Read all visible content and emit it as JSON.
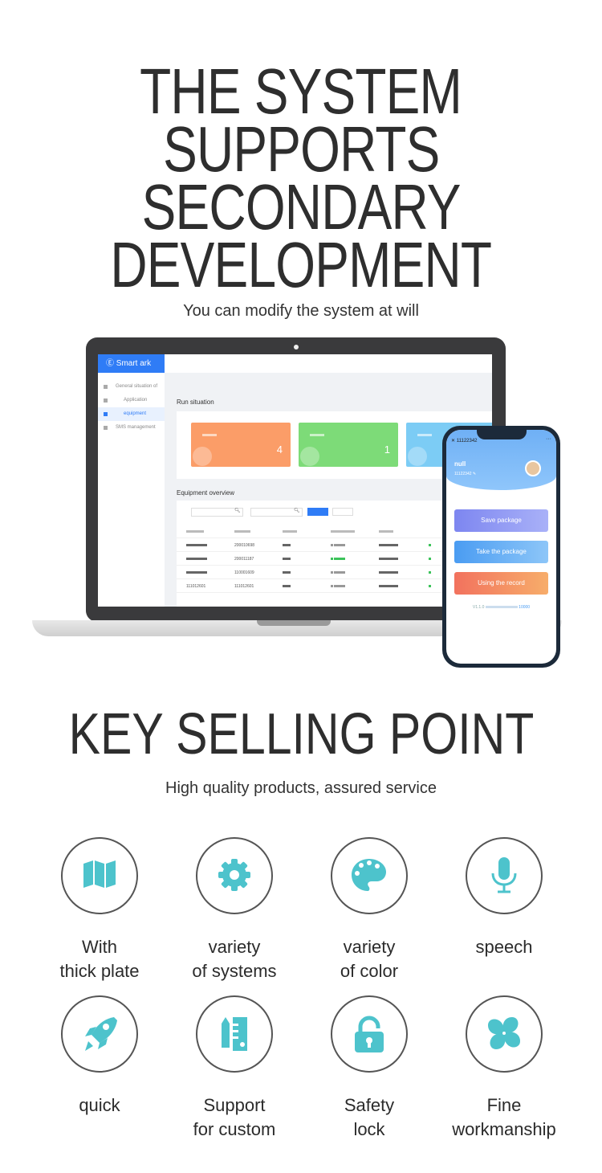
{
  "headline": [
    "THE SYSTEM",
    "SUPPORTS",
    "SECONDARY",
    "DEVELOPMENT"
  ],
  "headline_sub": "You can modify the system at will",
  "accent_color": "#4dc3cc",
  "laptop": {
    "brand": "Smart ark",
    "nav": [
      {
        "label": "General situation of",
        "icon": "flag-icon"
      },
      {
        "label": "Application",
        "icon": "grid-icon"
      },
      {
        "label": "equipment",
        "icon": "device-icon",
        "active": true
      },
      {
        "label": "SMS management",
        "icon": "message-icon"
      }
    ],
    "run_title": "Run situation",
    "cards": [
      {
        "value": "4",
        "color": "#fb9d68",
        "icon": "pie-icon"
      },
      {
        "value": "1",
        "color": "#7ddb78",
        "icon": "check-icon"
      },
      {
        "value": "",
        "color": "#7cccf5",
        "icon": "clock-icon"
      }
    ],
    "overview_title": "Equipment overview",
    "rows": [
      {
        "code": "200010698",
        "status_color": "#999"
      },
      {
        "code": "200011187",
        "status_color": "#3cc35a"
      },
      {
        "code": "110001609",
        "status_color": "#999"
      },
      {
        "name": "111012601",
        "code": "111012601",
        "status_color": "#999"
      }
    ]
  },
  "phone": {
    "top": "11122342",
    "name": "null",
    "id": "11122342",
    "buttons": [
      "Save package",
      "Take the package",
      "Using the record"
    ],
    "footer": "V1.1.0",
    "footer_link": "10000"
  },
  "selling": {
    "title": "KEY SELLING POINT",
    "subtitle": "High quality products, assured service",
    "features": [
      {
        "label": "With\nthick plate",
        "icon": "map-icon"
      },
      {
        "label": "variety\nof systems",
        "icon": "gear-icon"
      },
      {
        "label": "variety\nof color",
        "icon": "palette-icon"
      },
      {
        "label": "speech",
        "icon": "microphone-icon"
      },
      {
        "label": "quick",
        "icon": "rocket-icon"
      },
      {
        "label": "Support\nfor custom",
        "icon": "pencil-ruler-icon"
      },
      {
        "label": "Safety\nlock",
        "icon": "lock-icon"
      },
      {
        "label": "Fine\nworkmanship",
        "icon": "fan-icon"
      }
    ]
  }
}
